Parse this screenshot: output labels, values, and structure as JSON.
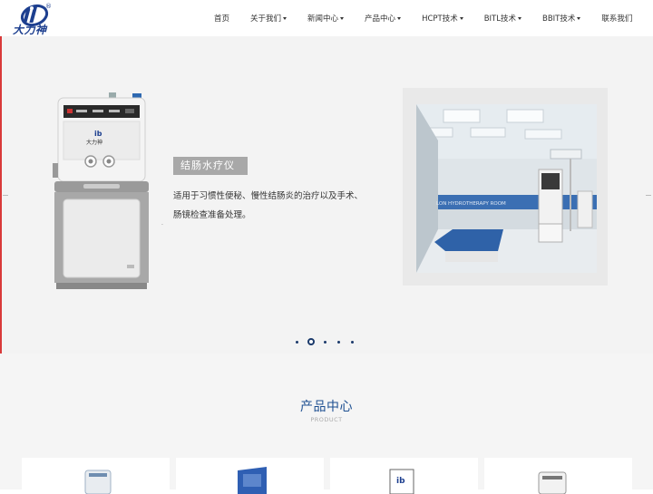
{
  "brand": {
    "logo_text": "大力神",
    "registered_mark": "®",
    "color": "#1d3f8f"
  },
  "nav": {
    "items": [
      {
        "label": "首页",
        "dropdown": false
      },
      {
        "label": "关于我们",
        "dropdown": true
      },
      {
        "label": "新闻中心",
        "dropdown": true
      },
      {
        "label": "产品中心",
        "dropdown": true
      },
      {
        "label": "HCPT技术",
        "dropdown": true
      },
      {
        "label": "BITL技术",
        "dropdown": true
      },
      {
        "label": "BBIT技术",
        "dropdown": true
      },
      {
        "label": "联系我们",
        "dropdown": false
      }
    ]
  },
  "banner": {
    "product_title": "结肠水疗仪",
    "product_desc_line1": "适用于习惯性便秘、慢性结肠炎的治疗以及手术、",
    "product_desc_line2": "肠镜检查准备处理。",
    "photo_wall_text": "LON HYDROTHERAPY ROOM",
    "machine_logo": "大力神",
    "carousel": {
      "count": 5,
      "active_index": 1
    },
    "accent_edge_color": "#d93a3a"
  },
  "products_section": {
    "title": "产品中心",
    "subtitle": "PRODUCT",
    "title_color": "#1d4f91"
  },
  "icons": [
    "brand-logo-icon",
    "caret-down-icon"
  ]
}
